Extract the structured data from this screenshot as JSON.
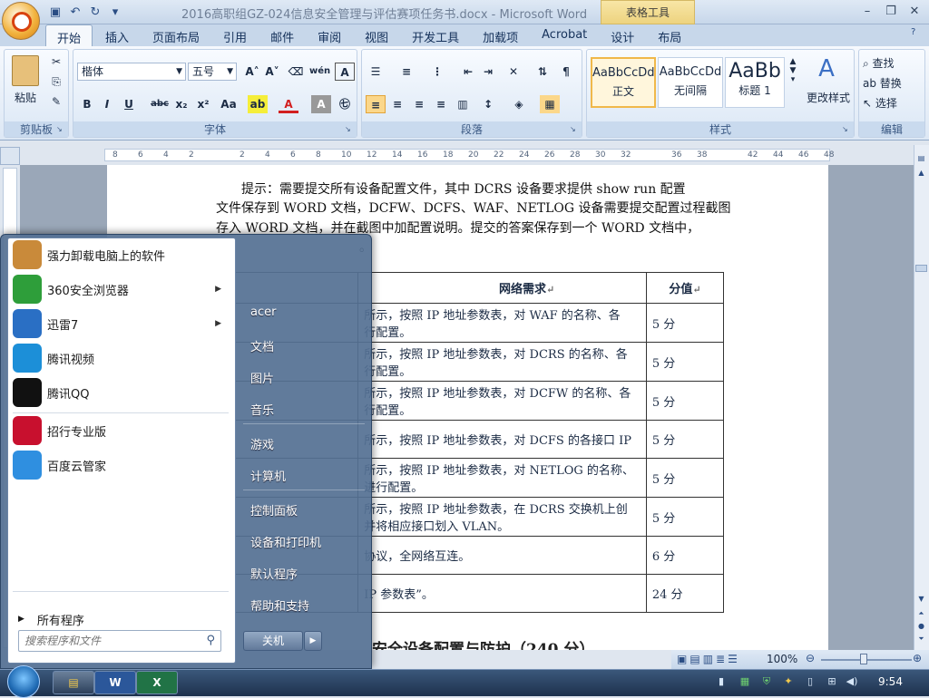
{
  "window": {
    "title": "2016高职组GZ-024信息安全管理与评估赛项任务书.docx - Microsoft Word",
    "contextual_tab": "表格工具"
  },
  "tabs": [
    "开始",
    "插入",
    "页面布局",
    "引用",
    "邮件",
    "审阅",
    "视图",
    "开发工具",
    "加载项",
    "Acrobat",
    "设计",
    "布局"
  ],
  "ribbon": {
    "clipboard": {
      "paste": "粘贴",
      "group": "剪贴板"
    },
    "font": {
      "family": "楷体",
      "size": "五号",
      "group": "字体",
      "buttons": [
        "B",
        "I",
        "U",
        "abc",
        "x₂",
        "x²",
        "Aa"
      ]
    },
    "paragraph": {
      "group": "段落"
    },
    "styles": {
      "group": "样式",
      "items": [
        {
          "sample": "AaBbCcDd",
          "name": "正文"
        },
        {
          "sample": "AaBbCcDd",
          "name": "无间隔"
        },
        {
          "sample": "AaBb",
          "name": "标题 1"
        }
      ],
      "change": "更改样式"
    },
    "editing": {
      "group": "编辑",
      "find": "查找",
      "replace": "替换",
      "select": "选择"
    }
  },
  "ruler": {
    "ticks": [
      "8",
      "6",
      "4",
      "2",
      "",
      "2",
      "4",
      "6",
      "8",
      "10",
      "12",
      "14",
      "16",
      "18",
      "20",
      "22",
      "24",
      "26",
      "28",
      "30",
      "32",
      "",
      "36",
      "38",
      "",
      "42",
      "44",
      "46",
      "48"
    ]
  },
  "document": {
    "lines": [
      "提示：需要提交所有设备配置文件，其中 DCRS 设备要求提供 show run 配置",
      "文件保存到 WORD 文档，DCFW、DCFS、WAF、NETLOG 设备需要提交配置过程截图",
      "存入 WORD 文档，并在截图中加配置说明。提交的答案保存到一个 WORD 文档中，",
      "。"
    ],
    "table": {
      "headers": [
        "网络需求",
        "分值"
      ],
      "rows": [
        {
          "req": "所示，按照 IP 地址参数表，对 WAF 的名称、各",
          "req2": "行配置。",
          "score": "5 分"
        },
        {
          "req": "所示，按照 IP 地址参数表，对 DCRS 的名称、各",
          "req2": "行配置。",
          "score": "5 分"
        },
        {
          "req": "所示，按照 IP 地址参数表，对 DCFW 的名称、各",
          "req2": "行配置。",
          "score": "5 分"
        },
        {
          "req": "所示，按照 IP 地址参数表，对 DCFS 的各接口 IP",
          "req2": "",
          "score": "5 分"
        },
        {
          "req": "所示，按照 IP 地址参数表，对 NETLOG 的名称、",
          "req2": "进行配置。",
          "score": "5 分"
        },
        {
          "req": "所示，按照 IP 地址参数表，在 DCRS 交换机上创",
          "req2": "并将相应接口划入 VLAN。",
          "score": "5 分"
        },
        {
          "req": "协议，全网络互连。",
          "req2": "",
          "score": "6 分"
        },
        {
          "req": "IP 参数表”。",
          "req2": "",
          "score": "24 分"
        }
      ]
    },
    "heading_partial": "安全设备配置与防护（240 分）"
  },
  "statusbar": {
    "zoom": "100%"
  },
  "start_menu": {
    "pinned": [
      {
        "label": "强力卸载电脑上的软件",
        "icon": "uninstaller-icon",
        "color": "#c98a3a",
        "arrow": false
      },
      {
        "label": "360安全浏览器",
        "icon": "browser-360-icon",
        "color": "#2e9e3a",
        "arrow": true
      },
      {
        "label": "迅雷7",
        "icon": "thunder-icon",
        "color": "#2a6fc4",
        "arrow": true
      },
      {
        "label": "腾讯视频",
        "icon": "tencent-video-icon",
        "color": "#1c8fd8",
        "arrow": false
      },
      {
        "label": "腾讯QQ",
        "icon": "qq-icon",
        "color": "#111111",
        "arrow": false
      },
      {
        "label": "招行专业版",
        "icon": "cmb-icon",
        "color": "#c8102e",
        "arrow": false
      },
      {
        "label": "百度云管家",
        "icon": "baidu-cloud-icon",
        "color": "#2f8fe0",
        "arrow": false
      }
    ],
    "all_programs": "所有程序",
    "search_placeholder": "搜索程序和文件",
    "right": [
      "acer",
      "文档",
      "图片",
      "音乐",
      "游戏",
      "计算机",
      "控制面板",
      "设备和打印机",
      "默认程序",
      "帮助和支持"
    ],
    "shutdown": "关机"
  },
  "taskbar": {
    "clock": "9:54"
  }
}
